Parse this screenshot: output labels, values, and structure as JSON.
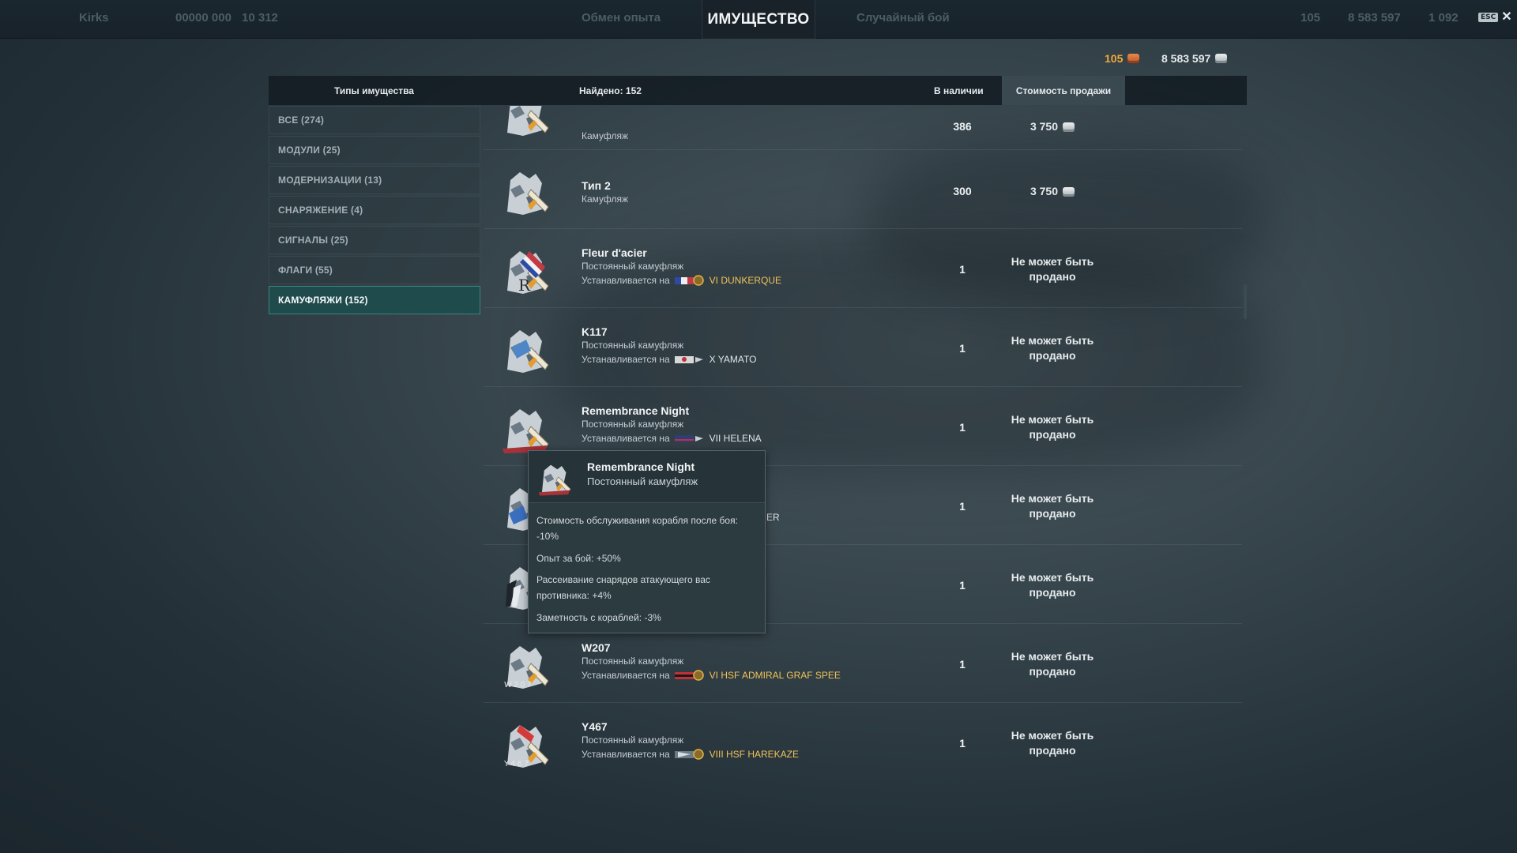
{
  "header": {
    "title": "ИМУЩЕСТВО",
    "esc_label": "ESC",
    "faded_left": [
      "Kirks",
      "00000 000",
      "10 312"
    ],
    "faded_center": [
      "Обмен опыта",
      "Случайный бой"
    ],
    "faded_right": [
      "105",
      "8 583 597",
      "1 092"
    ]
  },
  "currency": {
    "doubloons": "105",
    "credits": "8 583 597"
  },
  "table_header": {
    "types": "Типы имущества",
    "found": "Найдено: 152",
    "in_stock": "В наличии",
    "sell_price": "Стоимость продажи"
  },
  "categories": [
    {
      "label": "ВСЕ (274)",
      "active": false
    },
    {
      "label": "МОДУЛИ (25)",
      "active": false
    },
    {
      "label": "МОДЕРНИЗАЦИИ (13)",
      "active": false
    },
    {
      "label": "СНАРЯЖЕНИЕ (4)",
      "active": false
    },
    {
      "label": "СИГНАЛЫ (25)",
      "active": false
    },
    {
      "label": "ФЛАГИ (55)",
      "active": false
    },
    {
      "label": "КАМУФЛЯЖИ (152)",
      "active": true
    }
  ],
  "items": [
    {
      "name": "",
      "type": "Камуфляж",
      "qty": "386",
      "price": "3 750",
      "ship_label": "",
      "ship": ""
    },
    {
      "name": "Тип 2",
      "type": "Камуфляж",
      "qty": "300",
      "price": "3 750",
      "ship_label": "",
      "ship": ""
    },
    {
      "name": "Fleur d'acier",
      "type": "Постоянный камуфляж",
      "qty": "1",
      "price_line1": "Не может быть",
      "price_line2": "продано",
      "ship_label": "Устанавливается на",
      "ship": "VI DUNKERQUE"
    },
    {
      "name": "K117",
      "type": "Постоянный камуфляж",
      "qty": "1",
      "price_line1": "Не может быть",
      "price_line2": "продано",
      "ship_label": "Устанавливается на",
      "ship": "X YAMATO"
    },
    {
      "name": "Remembrance Night",
      "type": "Постоянный камуфляж",
      "qty": "1",
      "price_line1": "Не может быть",
      "price_line2": "продано",
      "ship_label": "Устанавливается на",
      "ship": "VII HELENA"
    },
    {
      "name": "",
      "type": "",
      "qty": "1",
      "price_line1": "Не может быть",
      "price_line2": "продано",
      "ship_label": "",
      "ship": "ER"
    },
    {
      "name": "",
      "type": "",
      "qty": "1",
      "price_line1": "Не может быть",
      "price_line2": "продано",
      "ship_label": "",
      "ship": ""
    },
    {
      "name": "W207",
      "type": "Постоянный камуфляж",
      "qty": "1",
      "price_line1": "Не может быть",
      "price_line2": "продано",
      "ship_label": "Устанавливается на",
      "ship": "VI HSF ADMIRAL GRAF SPEE"
    },
    {
      "name": "Y467",
      "type": "Постоянный камуфляж",
      "qty": "1",
      "price_line1": "Не может быть",
      "price_line2": "продано",
      "ship_label": "Устанавливается на",
      "ship": "VIII HSF HAREKAZE"
    }
  ],
  "tooltip": {
    "name": "Remembrance Night",
    "type": "Постоянный камуфляж",
    "lines": [
      "Стоимость обслуживания корабля после боя: -10%",
      "Опыт за бой: +50%",
      "Рассеивание снарядов атакующего вас противника: +4%",
      "Заметность с кораблей: -3%"
    ]
  },
  "icons": {
    "camo": "camouflage-brush-icon",
    "credit": "credits-coin-icon",
    "doubloon": "doubloon-coin-icon",
    "close": "close-icon",
    "ship_flag": "nation-flag-icon"
  },
  "colors": {
    "accent_active": "#1f4b4d",
    "ship_gold": "#f1c25a",
    "doubloon": "#f1a93a"
  }
}
